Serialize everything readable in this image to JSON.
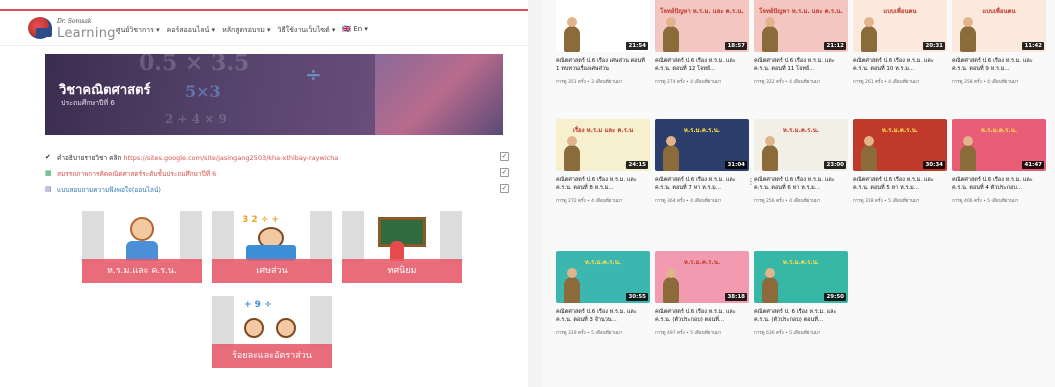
{
  "site": {
    "logo_top": "Dr. Somsak",
    "logo_text": "Learning",
    "nav": [
      "ศูนย์วิชาการ ▾",
      "คอร์สออนไลน์ ▾",
      "หลักสูตรอบรม ▾",
      "วิธีใช้งานเว็บไซต์ ▾",
      "🇬🇧 En ▾"
    ]
  },
  "hero": {
    "title": "วิชาคณิตศาสตร์",
    "subtitle": "ประถมศึกษาปีที่ 6",
    "deco": [
      "0.5 × 3.5",
      "5×3",
      "÷",
      "2 + 4 × 9"
    ]
  },
  "links": [
    {
      "icon": "✔",
      "text": "คำอธิบายรายวิชา  คลิก ",
      "url": "https://sites.google.com/site/jasingang2503/kha-xthibay-raywicha",
      "color": "url"
    },
    {
      "icon": "▦",
      "text": "สมรรถภาพการคิดคณิตศาสตร์ระดับชั้นประถมศึกษาปีที่ 6",
      "url": "",
      "color": "red"
    },
    {
      "icon": "▤",
      "text": "แบบสอบถามความพึงพอใจ(ออนไลน์)",
      "url": "",
      "color": "blue"
    }
  ],
  "cards": [
    {
      "label": "ห.ร.ม.และ ค.ร.น."
    },
    {
      "label": "เศษส่วน"
    },
    {
      "label": "ทศนิยม"
    },
    {
      "label": "ร้อยละและอัตราส่วน"
    }
  ],
  "videos": [
    {
      "title": "คณิตศาสตร์ ป.6 เรื่อง เศษส่วน ตอนที่ 1 ทบทวนเรื่องเศษส่วน",
      "meta": "การดู 351 ครั้ง • 3 เดือนที่ผ่านมา",
      "duration": "21:54",
      "band": "",
      "color": "#ffffff"
    },
    {
      "title": "คณิตศาสตร์ ป.6 เรื่อง ห.ร.ม. และ ค.ร.น. ตอนที่ 12 โจทย์...",
      "meta": "การดู 274 ครั้ง • 4 เดือนที่ผ่านมา",
      "duration": "18:57",
      "band": "โจทย์ปัญหา ห.ร.ม. และ ค.ร.น.",
      "color": "#f3c6c1"
    },
    {
      "title": "คณิตศาสตร์ ป.6 เรื่อง ห.ร.ม. และ ค.ร.น. ตอนที่ 11 โจทย์...",
      "meta": "การดู 322 ครั้ง • 4 เดือนที่ผ่านมา",
      "duration": "21:12",
      "band": "โจทย์ปัญหา ห.ร.ม. และ ค.ร.น.",
      "color": "#f3c6c1"
    },
    {
      "title": "คณิตศาสตร์ ป.6 เรื่อง ห.ร.ม. และ ค.ร.น. ตอนที่ 10 ห.ร.ม...",
      "meta": "การดู 261 ครั้ง • 4 เดือนที่ผ่านมา",
      "duration": "20:31",
      "band": "แบบเพื่อนคน",
      "color": "#fbe9dd"
    },
    {
      "title": "คณิตศาสตร์ ป.6 เรื่อง ห.ร.ม. และ ค.ร.น. ตอนที่ 9 ห.ร.ม...",
      "meta": "การดู 258 ครั้ง • 4 เดือนที่ผ่านมา",
      "duration": "11:42",
      "band": "แบบเพื่อนคน",
      "color": "#fbe9dd"
    },
    {
      "title": "คณิตศาสตร์ ป.6 เรื่อง ห.ร.ม. และ ค.ร.น. ตอนที่ 8 ห.ร.ม...",
      "meta": "การดู 272 ครั้ง • 4 เดือนที่ผ่านมา",
      "duration": "24:15",
      "band": "เรื่อง ห.ร.ม และ ค.ร.น",
      "color": "#f6f0cf"
    },
    {
      "title": "คณิตศาสตร์ ป.6 เรื่อง ห.ร.ม. และ ค.ร.น. ตอนที่ 7 หา ห.ร.ม...",
      "meta": "การดู 364 ครั้ง • 4 เดือนที่ผ่านมา",
      "duration": "31:04",
      "band": "ห.ร.ม.ค.ร.น.",
      "color": "#2c3e6b"
    },
    {
      "title": "คณิตศาสตร์ ป.6 เรื่อง ห.ร.ม. และ ค.ร.น. ตอนที่ 6 หา ห.ร.ม...",
      "meta": "การดู 256 ครั้ง • 4 เดือนที่ผ่านมา",
      "duration": "23:00",
      "band": "ห.ร.ม.ค.ร.น.",
      "color": "#f2efe6"
    },
    {
      "title": "คณิตศาสตร์ ป.6 เรื่อง ห.ร.ม. และ ค.ร.น. ตอนที่ 5 หา ห.ร.ม...",
      "meta": "การดู 318 ครั้ง • 5 เดือนที่ผ่านมา",
      "duration": "30:34",
      "band": "ห.ร.ม.ค.ร.น.",
      "color": "#c0392b"
    },
    {
      "title": "คณิตศาสตร์ ป.6 เรื่อง ห.ร.ม. และ ค.ร.น. ตอนที่ 4 ตัวประกอบ...",
      "meta": "การดู 406 ครั้ง • 5 เดือนที่ผ่านมา",
      "duration": "41:47",
      "band": "ห.ร.ม.ค.ร.น.",
      "color": "#e85d75"
    },
    {
      "title": "คณิตศาสตร์ ป.6 เรื่อง ห.ร.ม. และ ค.ร.น. ตอนที่ 3 จำนวน...",
      "meta": "การดู 319 ครั้ง • 5 เดือนที่ผ่านมา",
      "duration": "30:55",
      "band": "ห.ร.ม.ค.ร.น.",
      "color": "#3cb7b0"
    },
    {
      "title": "คณิตศาสตร์ ป.6 เรื่อง ห.ร.ม. และ ค.ร.น. (ตัวประกอบ) ตอนที่...",
      "meta": "การดู 497 ครั้ง • 5 เดือนที่ผ่านมา",
      "duration": "38:18",
      "band": "ห.ร.ม.ค.ร.น.",
      "color": "#f29bb0"
    },
    {
      "title": "คณิตศาสตร์ ป. 6 เรื่อง ห.ร.ม. และ ค.ร.น. (ตัวประกอบ) ตอนที่...",
      "meta": "การดู 636 ครั้ง • 5 เดือนที่ผ่านมา",
      "duration": "29:50",
      "band": "ห.ร.ม.ค.ร.น.",
      "color": "#37b7a6"
    }
  ],
  "icons": {
    "check": "check-icon",
    "menu": "more-vert-icon",
    "play": "play-icon"
  },
  "colors": {
    "accent": "#e85a6a",
    "hero": "#4f3f66"
  }
}
